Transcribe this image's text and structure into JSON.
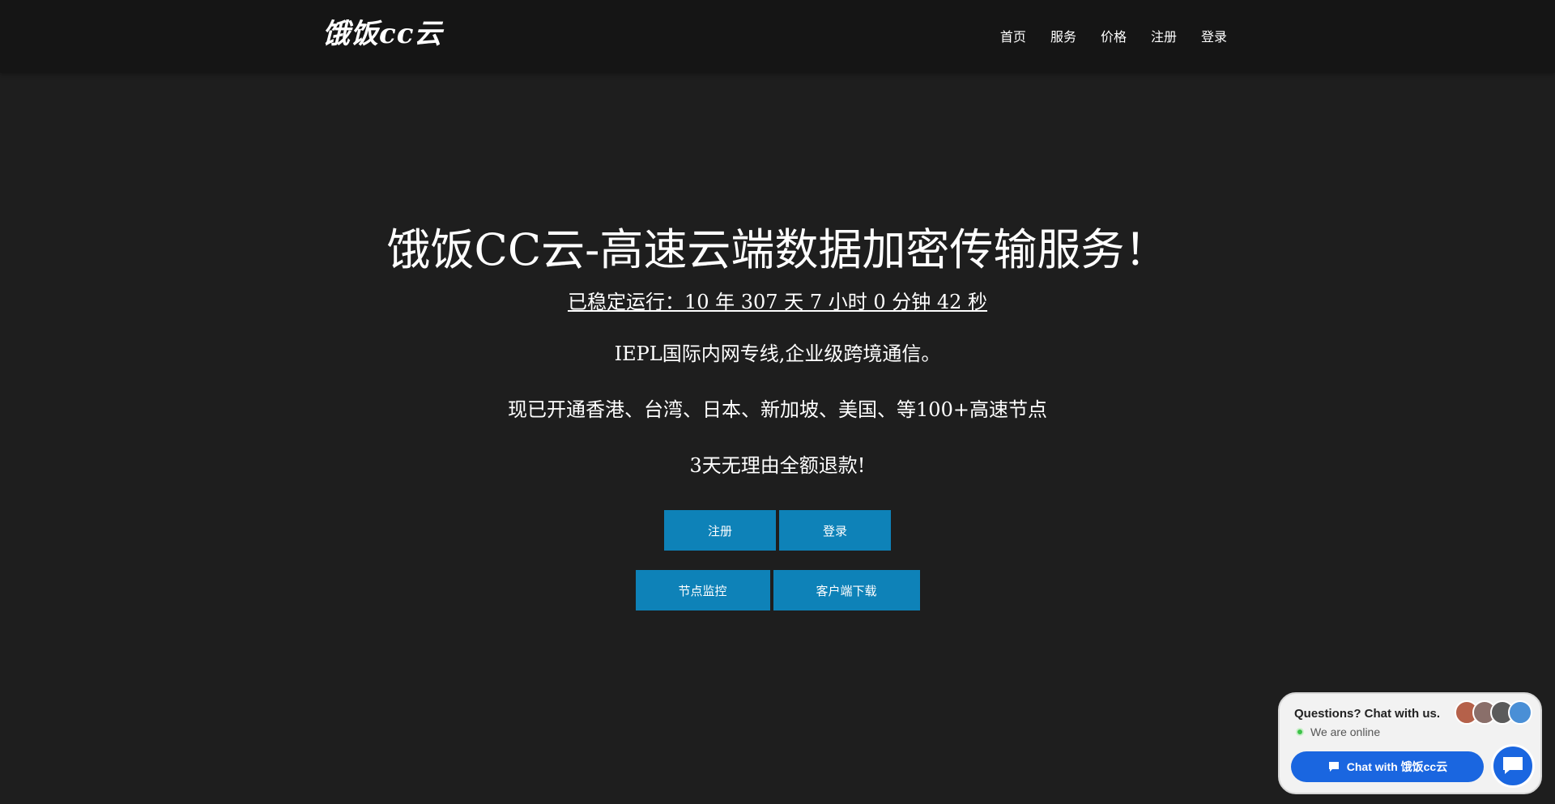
{
  "logo": "饿饭cc云",
  "nav": [
    "首页",
    "服务",
    "价格",
    "注册",
    "登录"
  ],
  "hero": {
    "title": "饿饭CC云-高速云端数据加密传输服务！",
    "uptime": "已稳定运行：10 年 307 天 7 小时 0 分钟 42 秒",
    "line1": "IEPL国际内网专线,企业级跨境通信。",
    "line2": "现已开通香港、台湾、日本、新加坡、美国、等100+高速节点",
    "line3": "3天无理由全额退款!"
  },
  "buttons": {
    "register": "注册",
    "login": "登录",
    "monitor": "节点监控",
    "download": "客户端下载"
  },
  "chat": {
    "question": "Questions? Chat with us.",
    "status": "We are online",
    "button": "Chat with 饿饭cc云"
  },
  "colors": {
    "accent": "#0e82b8",
    "chat_blue": "#1a66e0",
    "bg": "#1e1e1e"
  }
}
